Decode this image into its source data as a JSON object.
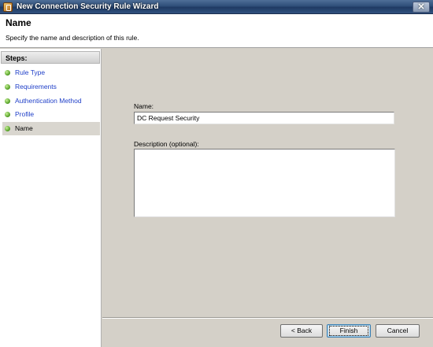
{
  "window": {
    "title": "New Connection Security Rule Wizard",
    "close_label": "✕"
  },
  "header": {
    "title": "Name",
    "subtitle": "Specify the name and description of this rule."
  },
  "steps": {
    "heading": "Steps:",
    "items": [
      {
        "label": "Rule Type"
      },
      {
        "label": "Requirements"
      },
      {
        "label": "Authentication Method"
      },
      {
        "label": "Profile"
      },
      {
        "label": "Name",
        "current": true
      }
    ]
  },
  "form": {
    "name_label": "Name:",
    "name_value": "DC Request Security",
    "description_label": "Description (optional):",
    "description_value": ""
  },
  "buttons": {
    "back": "< Back",
    "finish": "Finish",
    "cancel": "Cancel"
  }
}
